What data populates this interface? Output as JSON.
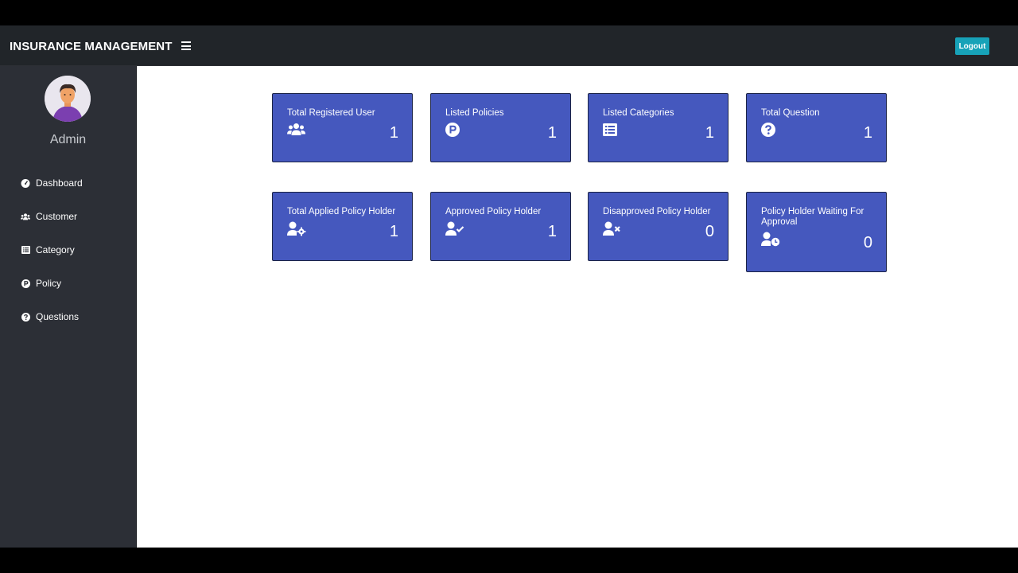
{
  "header": {
    "brand": "INSURANCE MANAGEMENT",
    "logout_label": "Logout"
  },
  "sidebar": {
    "user_name": "Admin",
    "items": [
      {
        "label": "Dashboard",
        "icon": "dashboard-icon"
      },
      {
        "label": "Customer",
        "icon": "users-icon"
      },
      {
        "label": "Category",
        "icon": "list-icon"
      },
      {
        "label": "Policy",
        "icon": "policy-p-icon"
      },
      {
        "label": "Questions",
        "icon": "question-icon"
      }
    ]
  },
  "cards": [
    {
      "title": "Total Registered User",
      "count": "1",
      "icon": "users-icon"
    },
    {
      "title": "Listed Policies",
      "count": "1",
      "icon": "policy-p-icon"
    },
    {
      "title": "Listed Categories",
      "count": "1",
      "icon": "list-icon"
    },
    {
      "title": "Total Question",
      "count": "1",
      "icon": "question-icon"
    },
    {
      "title": "Total Applied Policy Holder",
      "count": "1",
      "icon": "user-cog-icon"
    },
    {
      "title": "Approved Policy Holder",
      "count": "1",
      "icon": "user-check-icon"
    },
    {
      "title": "Disapproved Policy Holder",
      "count": "0",
      "icon": "user-times-icon"
    },
    {
      "title": "Policy Holder Waiting For Approval",
      "count": "0",
      "icon": "user-clock-icon"
    }
  ],
  "colors": {
    "topbar": "#212529",
    "sidebar": "#2c2f36",
    "card": "#4558be",
    "logout": "#17a2b8"
  }
}
